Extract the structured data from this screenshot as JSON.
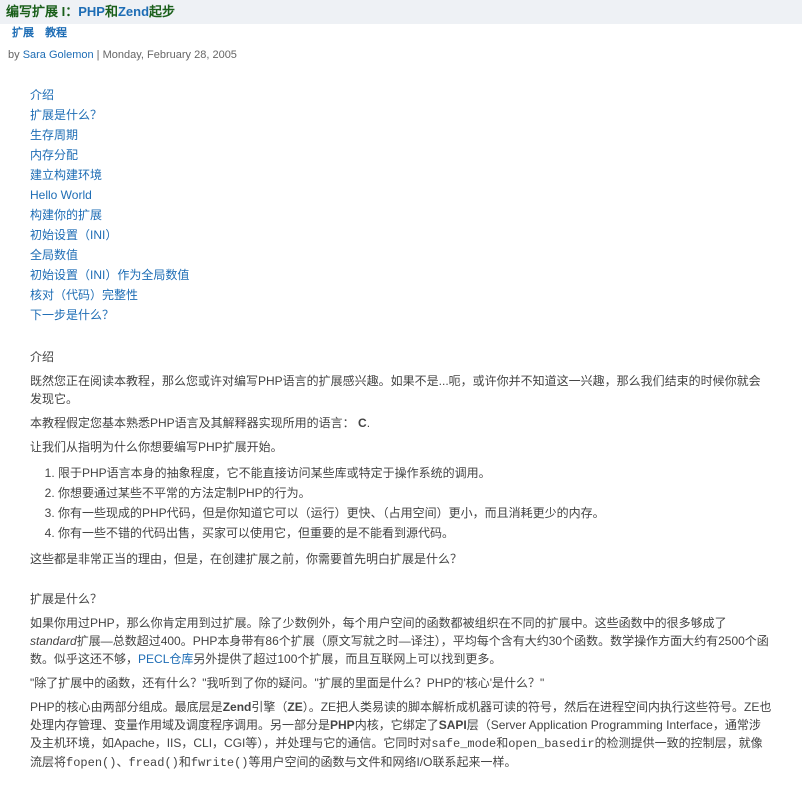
{
  "header": {
    "title_prefix": "编写扩展 I：",
    "title_mid": "PHP",
    "title_and": "和",
    "title_zend": "Zend",
    "title_suffix": "起步",
    "sublink1": "扩展",
    "sublink2": "教程"
  },
  "byline": {
    "by": "by  ",
    "author": "Sara Golemon",
    "sep": "  |  ",
    "date": "Monday, February 28, 2005"
  },
  "toc": {
    "items": [
      "介绍",
      "扩展是什么？",
      "生存周期",
      "内存分配",
      "建立构建环境",
      "Hello World",
      "构建你的扩展",
      "初始设置（INI）",
      "全局数值",
      "初始设置（INI）作为全局数值",
      "核对（代码）完整性",
      "下一步是什么？"
    ]
  },
  "intro": {
    "label": "介绍",
    "p1": "既然您正在阅读本教程，那么您或许对编写PHP语言的扩展感兴趣。如果不是...呃，或许你并不知道这一兴趣，那么我们结束的时候你就会发现它。",
    "p2a": "本教程假定您基本熟悉PHP语言及其解释器实现所用的语言：",
    "p2b": "C",
    "p2c": ".",
    "p3": "让我们从指明为什么你想要编写PHP扩展开始。",
    "list": [
      "限于PHP语言本身的抽象程度，它不能直接访问某些库或特定于操作系统的调用。",
      "你想要通过某些不平常的方法定制PHP的行为。",
      "你有一些现成的PHP代码，但是你知道它可以（运行）更快、（占用空间）更小，而且消耗更少的内存。",
      "你有一些不错的代码出售，买家可以使用它，但重要的是不能看到源代码。"
    ],
    "p4": "这些都是非常正当的理由，但是，在创建扩展之前，你需要首先明白扩展是什么？"
  },
  "whatis": {
    "label": "扩展是什么？",
    "p1a": "如果你用过PHP，那么你肯定用到过扩展。除了少数例外，每个用户空间的函数都被组织在不同的扩展中。这些函数中的很多够成了",
    "p1b": "standard",
    "p1c": "扩展—总数超过400。PHP本身带有86个扩展（原文写就之时—译注），平均每个含有大约30个函数。数学操作方面大约有2500个函数。似乎这还不够，",
    "p1d": "PECL仓库",
    "p1e": "另外提供了超过100个扩展，而且互联网上可以找到更多。",
    "p2": "\"除了扩展中的函数，还有什么？\"我听到了你的疑问。\"扩展的里面是什么？PHP的'核心'是什么？\"",
    "p3a": "PHP的核心由两部分组成。最底层是",
    "p3b": "Zend",
    "p3c": "引擎（",
    "p3d": "ZE",
    "p3e": "）。ZE把人类易读的脚本解析成机器可读的符号，然后在进程空间内执行这些符号。ZE也处理内存管理、变量作用域及调度程序调用。另一部分是",
    "p3f": "PHP",
    "p3g": "内核，它绑定了",
    "p3h": "SAPI",
    "p3i": "层（Server Application Programming Interface，通常涉及主机环境，如Apache，IIS，CLI，CGI等），并处理与它的通信。它同时对",
    "p3j": "safe_mode",
    "p3k": "和",
    "p3l": "open_basedir",
    "p3m": "的检测提供一致的控制层，就像流层将",
    "p3n": "fopen()",
    "p3o": "、",
    "p3p": "fread()",
    "p3q": "和",
    "p3r": "fwrite()",
    "p3s": "等用户空间的函数与文件和网络I/O联系起来一样。"
  }
}
